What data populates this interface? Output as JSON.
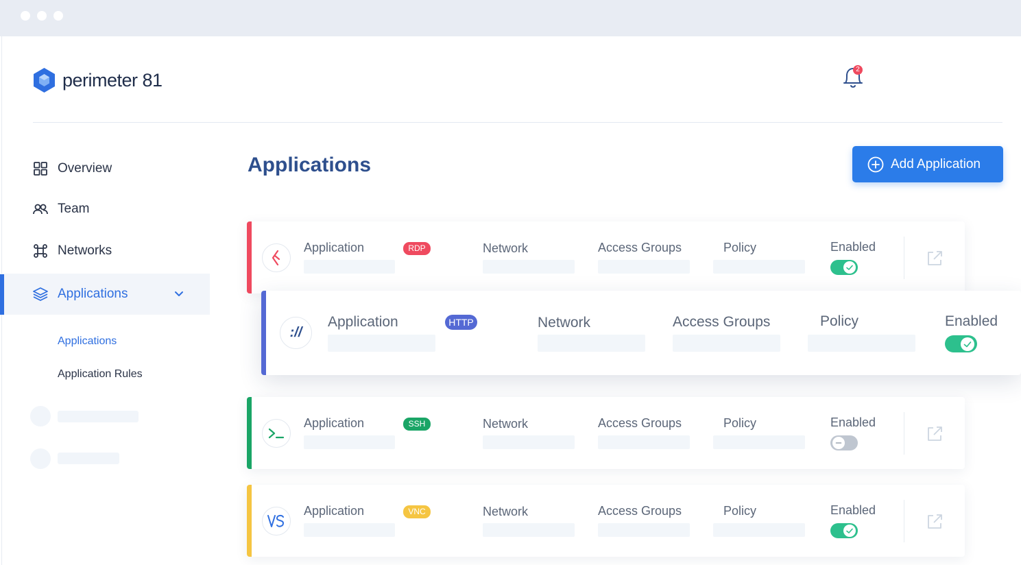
{
  "brand": {
    "logo_text": "perimeter 81",
    "accent": "#2f6fe0"
  },
  "notifications": {
    "count": "2",
    "icon": "bell-icon"
  },
  "sidebar": {
    "items": [
      {
        "label": "Overview",
        "icon": "grid-icon"
      },
      {
        "label": "Team",
        "icon": "users-icon"
      },
      {
        "label": "Networks",
        "icon": "network-icon"
      },
      {
        "label": "Applications",
        "icon": "layers-icon",
        "active": true
      }
    ],
    "subitems": [
      {
        "label": "Applications",
        "active": true
      },
      {
        "label": "Application Rules"
      }
    ]
  },
  "main": {
    "title": "Applications",
    "add_button": "Add Application",
    "columns": {
      "application": "Application",
      "network": "Network",
      "access_groups": "Access Groups",
      "policy": "Policy",
      "enabled": "Enabled"
    },
    "apps": [
      {
        "type": "RDP",
        "color": "#ef4a5f",
        "enabled": true
      },
      {
        "type": "HTTP",
        "color": "#5469d4",
        "enabled": true
      },
      {
        "type": "SSH",
        "color": "#1aa566",
        "enabled": false
      },
      {
        "type": "VNC",
        "color": "#f5c542",
        "enabled": true
      }
    ]
  }
}
